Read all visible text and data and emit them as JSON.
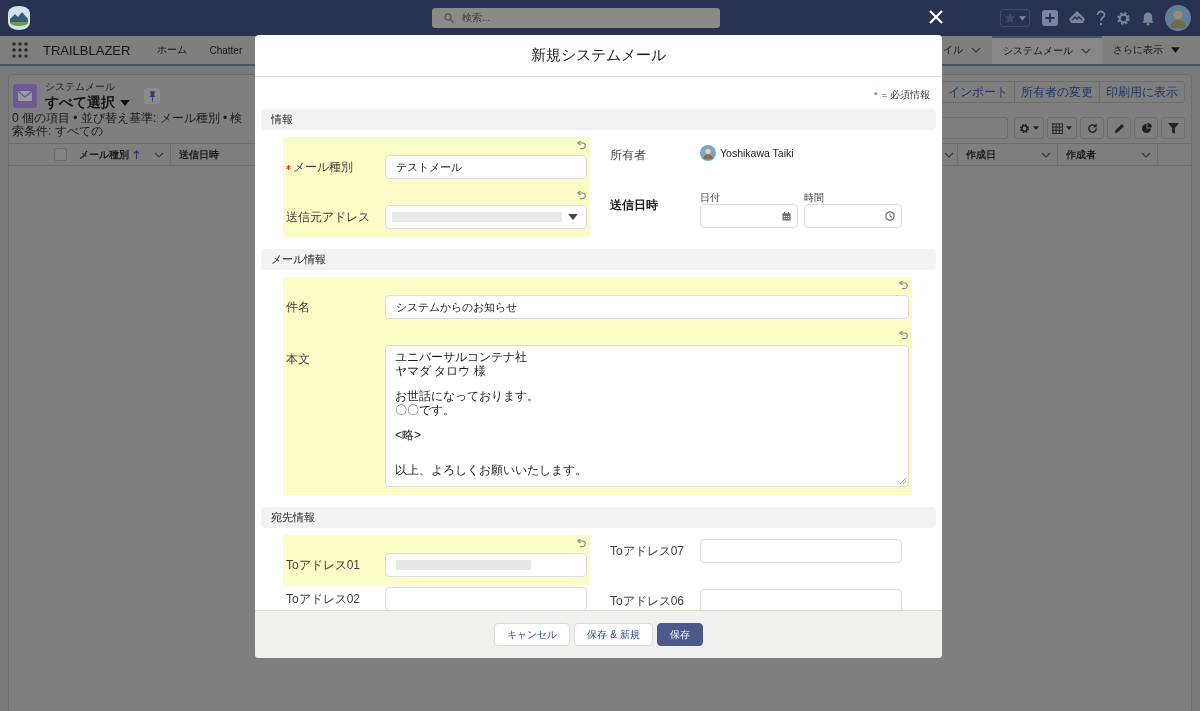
{
  "global_header": {
    "search_placeholder": "検索..."
  },
  "nav": {
    "app_name": "TRAILBLAZER",
    "tabs_left": [
      {
        "label": "ホーム",
        "selected": false,
        "kind": "tab",
        "dropdown": false
      },
      {
        "label": "Chatter",
        "selected": false,
        "kind": "tab",
        "dropdown": false
      }
    ],
    "tabs_right": [
      {
        "label": "イル",
        "selected": false,
        "kind": "tab",
        "dropdown": true
      },
      {
        "label": "システムメール",
        "selected": true,
        "kind": "tab",
        "dropdown": true
      },
      {
        "label": "さらに表示",
        "selected": false,
        "kind": "more"
      }
    ]
  },
  "list_view": {
    "object_label": "システムメール",
    "view_name": "すべて選択",
    "actions": [
      "インポート",
      "所有者の変更",
      "印刷用に表示"
    ],
    "select_all_checked": false,
    "status": "0 個の項目 • 並び替え基準: メール種別 • 検索条件: すべての",
    "columns_left": [
      {
        "label": "メール種別",
        "sorted": true
      },
      {
        "label": "送信日時",
        "sorted": false
      }
    ],
    "columns_right": [
      {
        "label": "作成日",
        "sorted": false
      },
      {
        "label": "作成者",
        "sorted": false
      }
    ]
  },
  "modal": {
    "title": "新規システムメール",
    "required_note": {
      "marker": "*",
      "text": "= 必須情報"
    },
    "sections": [
      {
        "title": "情報",
        "kind": "pairs",
        "rows": [
          [
            {
              "label": "メール種別",
              "kind": "text",
              "required": true,
              "edited": true,
              "value": "テストメール",
              "masked": false
            },
            {
              "label": "所有者",
              "kind": "owner",
              "required": false,
              "edited": false,
              "value": "Yoshikawa Taiki"
            }
          ],
          [
            {
              "label": "送信元アドレス",
              "kind": "select",
              "required": false,
              "edited": true,
              "masked": true
            },
            {
              "label": "送信日時",
              "kind": "datetime",
              "required": false,
              "edited": false,
              "parts": [
                {
                  "label": "日付",
                  "kind": "date"
                },
                {
                  "label": "時間",
                  "kind": "time"
                }
              ]
            }
          ]
        ]
      },
      {
        "title": "メール情報",
        "kind": "full",
        "fields": [
          {
            "label": "件名",
            "kind": "text",
            "required": false,
            "edited": true,
            "value": "システムからのお知らせ",
            "masked": false
          },
          {
            "label": "本文",
            "kind": "textarea",
            "required": false,
            "edited": true,
            "paragraphs": [
              [
                "ユニバーサルコンテナ社",
                "ヤマダ タロウ 様"
              ],
              [
                "お世話になっております。",
                "〇〇です。"
              ],
              [
                "<略>"
              ],
              [
                "以上、よろしくお願いいたします。"
              ]
            ]
          }
        ]
      },
      {
        "title": "宛先情報",
        "kind": "pairs",
        "rows": [
          [
            {
              "label": "Toアドレス01",
              "kind": "text",
              "required": false,
              "edited": true,
              "masked": true
            },
            {
              "label": "Toアドレス07",
              "kind": "text",
              "required": false,
              "edited": false,
              "masked": false
            }
          ],
          [
            {
              "label": "Toアドレス02",
              "kind": "text",
              "required": false,
              "edited": false,
              "masked": false
            },
            {
              "label": "Toアドレス06",
              "kind": "text",
              "required": false,
              "edited": false,
              "masked": false
            }
          ]
        ]
      }
    ],
    "buttons": [
      {
        "label": "キャンセル",
        "kind": "neutral"
      },
      {
        "label": "保存 & 新規",
        "kind": "neutral"
      },
      {
        "label": "保存",
        "kind": "brand"
      }
    ]
  }
}
